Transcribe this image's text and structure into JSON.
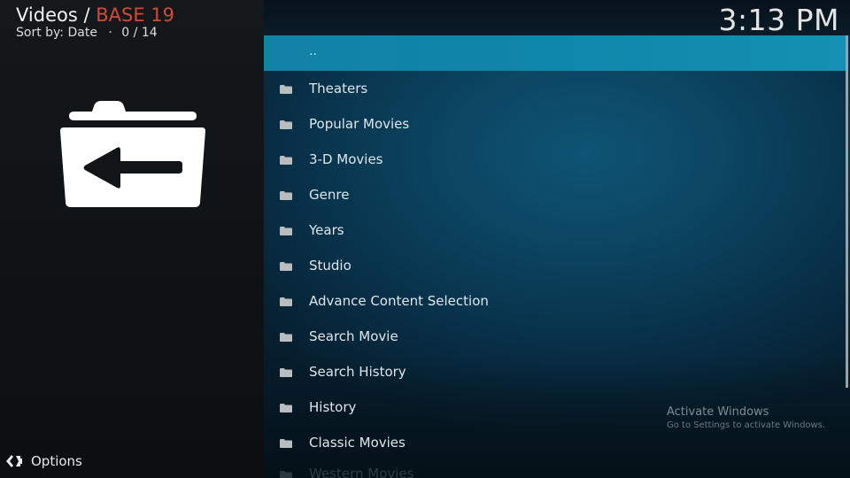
{
  "header": {
    "section": "Videos / ",
    "addon": "BASE 19",
    "sort_label": "Sort by: Date",
    "separator": "·",
    "position": "0 / 14"
  },
  "clock": "3:13 PM",
  "sidebar": {
    "main_icon": "folder-back-icon",
    "options_label": "Options",
    "options_icon": "options-chevrons-icon"
  },
  "list": {
    "items": [
      {
        "label": "..",
        "icon": "none",
        "selected": true
      },
      {
        "label": "Theaters",
        "icon": "folder-icon"
      },
      {
        "label": "Popular Movies",
        "icon": "folder-icon"
      },
      {
        "label": "3-D Movies",
        "icon": "folder-icon"
      },
      {
        "label": "Genre",
        "icon": "folder-icon"
      },
      {
        "label": "Years",
        "icon": "folder-icon"
      },
      {
        "label": "Studio",
        "icon": "folder-icon"
      },
      {
        "label": "Advance Content Selection",
        "icon": "folder-icon"
      },
      {
        "label": "Search Movie",
        "icon": "folder-icon"
      },
      {
        "label": "Search History",
        "icon": "folder-icon"
      },
      {
        "label": "History",
        "icon": "folder-icon"
      },
      {
        "label": "Classic Movies",
        "icon": "folder-icon"
      },
      {
        "label": "Western Movies",
        "icon": "folder-icon"
      }
    ]
  },
  "watermark": {
    "title": "Activate Windows",
    "subtitle": "Go to Settings to activate Windows."
  },
  "colors": {
    "accent_red": "#d24a3a",
    "selection": "#1282a6"
  }
}
